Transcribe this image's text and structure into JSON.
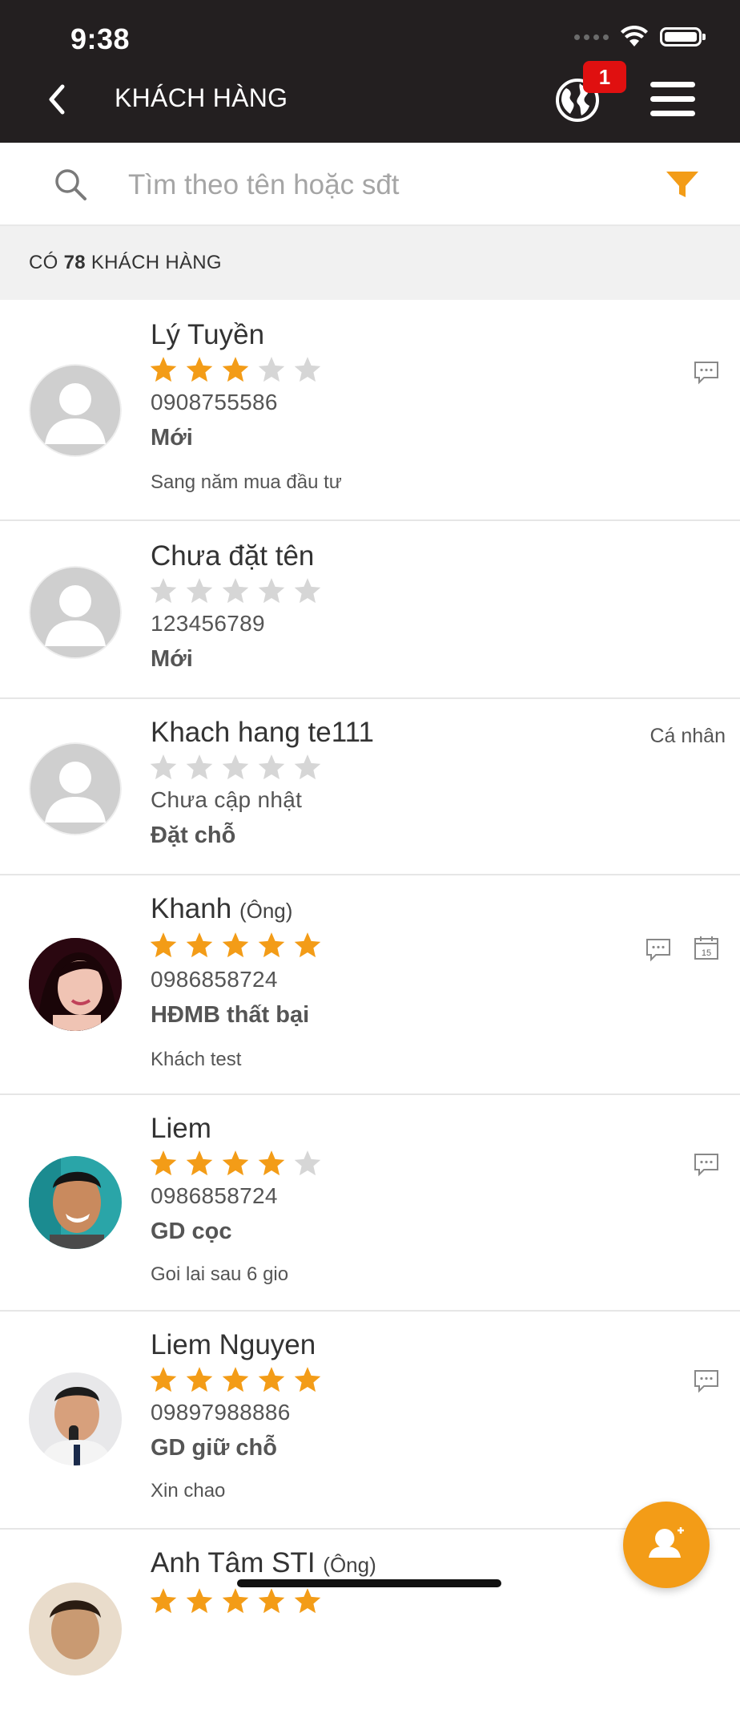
{
  "status_bar": {
    "time": "9:38"
  },
  "header": {
    "title": "KHÁCH HÀNG",
    "notification_count": "1"
  },
  "search": {
    "placeholder": "Tìm theo tên hoặc sđt",
    "value": ""
  },
  "summary": {
    "prefix": "CÓ",
    "count": "78",
    "suffix": "KHÁCH HÀNG"
  },
  "colors": {
    "accent": "#f39c17",
    "header_bg": "#231f20",
    "badge": "#e01010",
    "star_empty": "#d6d6d6"
  },
  "customers": [
    {
      "name": "Lý Tuyền",
      "title": "",
      "rating": 3,
      "phone": "0908755586",
      "status": "Mới",
      "note": "Sang năm mua đầu tư",
      "type": "",
      "avatar": "placeholder",
      "icons": [
        "chat-icon"
      ]
    },
    {
      "name": "Chưa đặt tên",
      "title": "",
      "rating": 0,
      "phone": "123456789",
      "status": "Mới",
      "note": "",
      "type": "",
      "avatar": "placeholder",
      "icons": []
    },
    {
      "name": "Khach hang te111",
      "title": "",
      "rating": 0,
      "phone": "Chưa cập nhật",
      "status": "Đặt chỗ",
      "note": "",
      "type": "Cá nhân",
      "avatar": "placeholder",
      "icons": []
    },
    {
      "name": "Khanh",
      "title": "(Ông)",
      "rating": 5,
      "phone": "0986858724",
      "status": "HĐMB thất bại",
      "note": "Khách test",
      "type": "",
      "avatar": "photo-woman",
      "icons": [
        "chat-icon",
        "calendar-icon"
      ],
      "calendar_day": "15"
    },
    {
      "name": "Liem",
      "title": "",
      "rating": 4,
      "phone": "0986858724",
      "status": "GD cọc",
      "note": "Goi lai sau 6 gio",
      "type": "",
      "avatar": "photo-man-smiling",
      "icons": [
        "chat-icon"
      ]
    },
    {
      "name": "Liem Nguyen",
      "title": "",
      "rating": 5,
      "phone": "09897988886",
      "status": "GD giữ chỗ",
      "note": "Xin chao",
      "type": "",
      "avatar": "photo-man-microphone",
      "icons": [
        "chat-icon"
      ]
    },
    {
      "name": "Anh Tâm STI",
      "title": "(Ông)",
      "rating": 5,
      "phone": "",
      "status": "",
      "note": "",
      "type": "",
      "avatar": "photo-man",
      "icons": []
    }
  ]
}
